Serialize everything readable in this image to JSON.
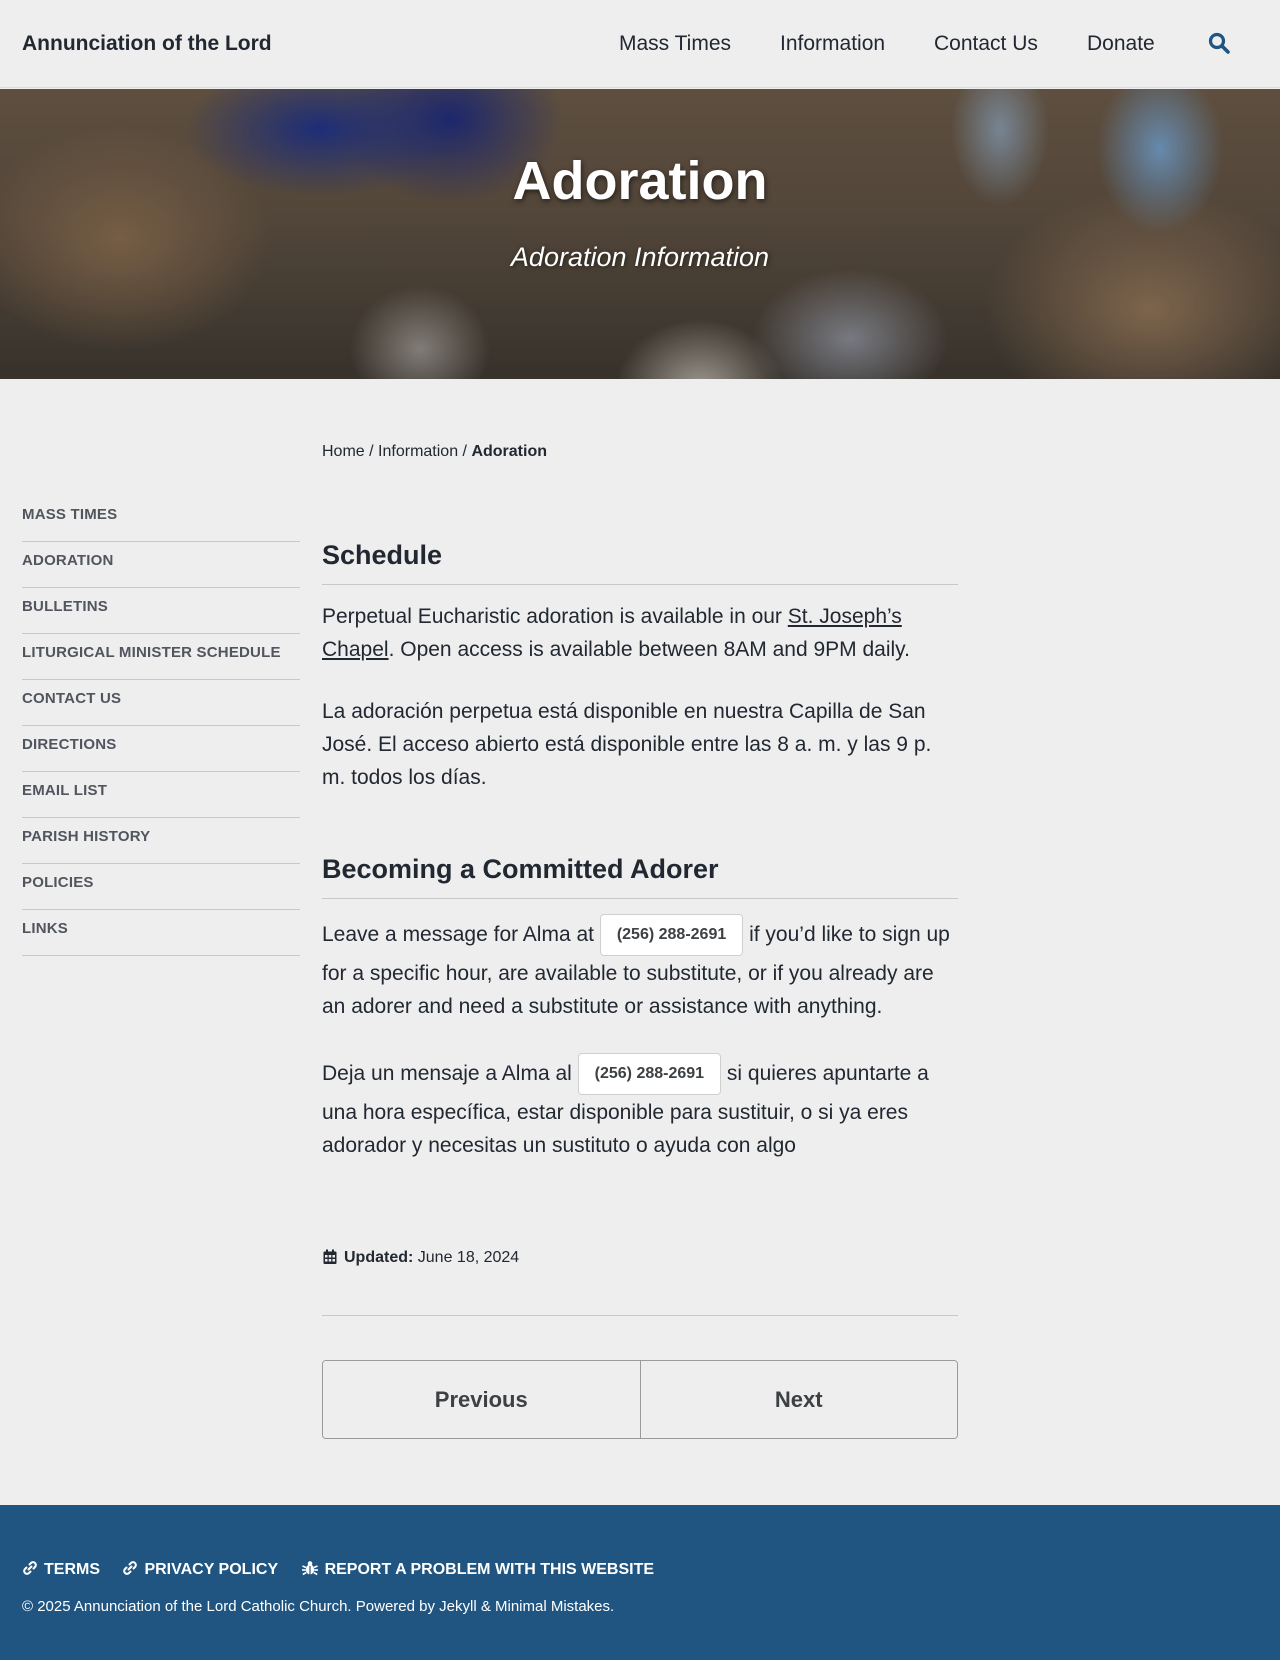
{
  "masthead": {
    "site_title": "Annunciation of the Lord",
    "nav": [
      "Mass Times",
      "Information",
      "Contact Us",
      "Donate"
    ],
    "search_icon": "search-icon"
  },
  "hero": {
    "title": "Adoration",
    "excerpt": "Adoration Information"
  },
  "breadcrumbs": {
    "home": "Home",
    "sep": "/",
    "parent": "Information",
    "current": "Adoration"
  },
  "sidebar": {
    "items": [
      "MASS TIMES",
      "ADORATION",
      "BULLETINS",
      "LITURGICAL MINISTER SCHEDULE",
      "CONTACT US",
      "DIRECTIONS",
      "EMAIL LIST",
      "PARISH HISTORY",
      "POLICIES",
      "LINKS"
    ]
  },
  "content": {
    "schedule_heading": "Schedule",
    "schedule_p1_before": "Perpetual Eucharistic adoration is available in our ",
    "schedule_p1_link": "St. Joseph’s Chapel",
    "schedule_p1_after": ". Open access is available between 8AM and 9PM daily.",
    "schedule_p2": "La adoración perpetua está disponible en nuestra Capilla de San José. El acceso abierto está disponible entre las 8 a. m. y las 9 p. m. todos los días.",
    "adorer_heading": "Becoming a Committed Adorer",
    "adorer_p1_before": "Leave a message for Alma at ",
    "phone": "(256) 288-2691",
    "adorer_p1_after": " if you’d like to sign up for a specific hour, are available to substitute, or if you already are an adorer and need a substitute or assistance with anything.",
    "adorer_p2_before": "Deja un mensaje a Alma al ",
    "adorer_p2_after": " si quieres apuntarte a una hora específica, estar disponible para sustituir, o si ya eres adorador y necesitas un sustituto o ayuda con algo"
  },
  "updated": {
    "icon": "calendar-icon",
    "label": "Updated:",
    "date": "June 18, 2024"
  },
  "pager": {
    "previous": "Previous",
    "next": "Next"
  },
  "footer": {
    "links": [
      {
        "label": "TERMS",
        "icon": "link-icon"
      },
      {
        "label": "PRIVACY POLICY",
        "icon": "link-icon"
      },
      {
        "label": "REPORT A PROBLEM WITH THIS WEBSITE",
        "icon": "bug-icon"
      }
    ],
    "copyright": "© 2025 Annunciation of the Lord Catholic Church. Powered by Jekyll & Minimal Mistakes."
  },
  "colors": {
    "background": "#eeeeee",
    "text": "#222831",
    "footer": "#1f5580",
    "search_icon": "#1f5580",
    "sidebar_text": "#51555d"
  }
}
